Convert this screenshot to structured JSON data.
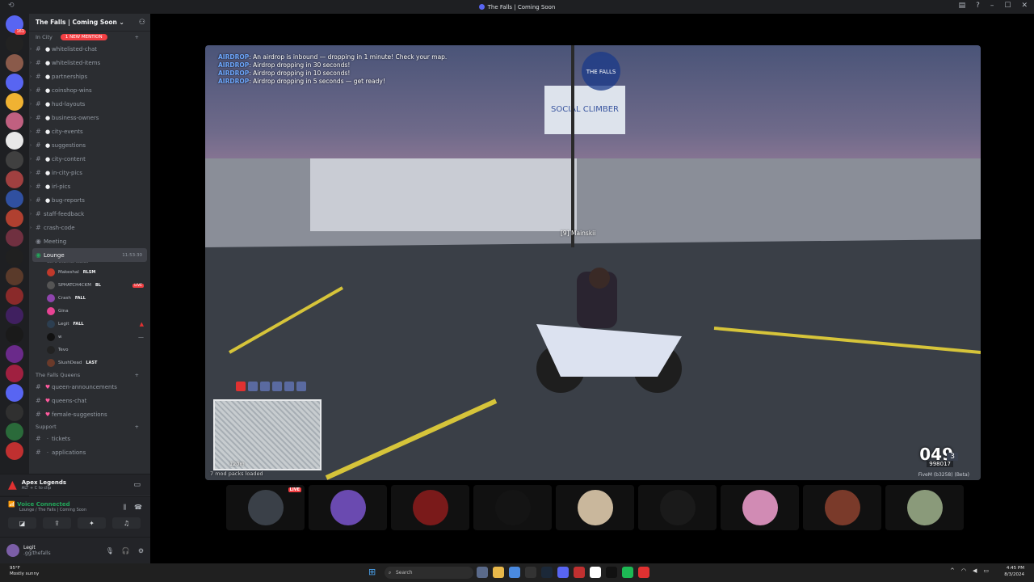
{
  "window": {
    "title": "The Falls | Coming Soon"
  },
  "server": {
    "name": "The Falls | Coming Soon"
  },
  "category_in_city": {
    "label": "In City",
    "badge": "1 NEW MENTION"
  },
  "channels": [
    {
      "name": "whitelisted-chat",
      "emoji": "💬"
    },
    {
      "name": "whitelisted-items",
      "emoji": "💬"
    },
    {
      "name": "partnerships",
      "emoji": "💬"
    },
    {
      "name": "coinshop-wins",
      "emoji": "💬"
    },
    {
      "name": "hud-layouts",
      "emoji": "💬"
    },
    {
      "name": "business-owners",
      "emoji": "💬"
    },
    {
      "name": "city-events",
      "emoji": "💬"
    },
    {
      "name": "suggestions",
      "emoji": "💬"
    },
    {
      "name": "city-content",
      "emoji": "💬"
    },
    {
      "name": "in-city-pics",
      "emoji": "💬"
    },
    {
      "name": "irl-pics",
      "emoji": "💬"
    },
    {
      "name": "bug-reports",
      "emoji": "💬"
    },
    {
      "name": "staff-feedback",
      "emoji": ""
    },
    {
      "name": "crash-code",
      "emoji": ""
    }
  ],
  "meeting": {
    "name": "Meeting"
  },
  "lounge": {
    "name": "Lounge",
    "time": "11:53:30",
    "status": "Set a channel status"
  },
  "voice_users": [
    {
      "name": "Makeshal",
      "tag": "RLSM",
      "right": ""
    },
    {
      "name": "SPHATCH4CKM",
      "tag": "BL",
      "right": "LIVE"
    },
    {
      "name": "Crash",
      "tag": "FALL",
      "right": ""
    },
    {
      "name": "Gina",
      "tag": "",
      "right": ""
    },
    {
      "name": "Legit",
      "tag": "FALL",
      "right": "apex"
    },
    {
      "name": "w",
      "tag": "",
      "right": "—"
    },
    {
      "name": "Tevo",
      "tag": "",
      "right": ""
    },
    {
      "name": "SlushDead",
      "tag": "LAST",
      "right": ""
    }
  ],
  "category_queens": {
    "label": "The Falls Queens"
  },
  "queens_channels": [
    {
      "name": "queen-announcements"
    },
    {
      "name": "queens-chat"
    },
    {
      "name": "female-suggestions"
    }
  ],
  "category_support": {
    "label": "Support"
  },
  "support_channels": [
    {
      "name": "tickets"
    },
    {
      "name": "applications"
    }
  ],
  "activity": {
    "game": "Apex Legends",
    "hint": "ALT + C  to clip"
  },
  "voice": {
    "status": "Voice Connected",
    "location": "Lounge / The Falls | Coming Soon"
  },
  "user": {
    "name": "Legit",
    "status": ".gg/thefalls"
  },
  "game": {
    "chat": [
      {
        "tag": "AIRDROP",
        "text": ": An airdrop is inbound — dropping in 1 minute! Check your map."
      },
      {
        "tag": "AIRDROP",
        "text": ": Airdrop dropping in 30 seconds!"
      },
      {
        "tag": "AIRDROP",
        "text": ": Airdrop dropping in 10 seconds!"
      },
      {
        "tag": "AIRDROP",
        "text": ": Airdrop dropping in 5 seconds — get ready!"
      }
    ],
    "player": "[9] Mainskii",
    "speed": "049",
    "gear": "3",
    "money": "998017",
    "fivem": "FiveM (b3258) (Beta)",
    "mods": "7 mod packs loaded",
    "zoom": "120m",
    "billboard": "SOCIAL CLIMBER",
    "logo": "THE FALLS"
  },
  "tiles": [
    {
      "color": "#3a4048",
      "live": "LIVE"
    },
    {
      "color": "#6a4ab0",
      "live": ""
    },
    {
      "color": "#7a1a1a",
      "live": ""
    },
    {
      "color": "#141414",
      "live": ""
    },
    {
      "color": "#c9b79c",
      "live": ""
    },
    {
      "color": "#1a1a1a",
      "live": ""
    },
    {
      "color": "#d18bb4",
      "live": ""
    },
    {
      "color": "#7a3a2a",
      "live": ""
    },
    {
      "color": "#8a9a7a",
      "live": ""
    }
  ],
  "taskbar": {
    "weather_temp": "95°F",
    "weather_desc": "Mostly sunny",
    "search": "Search",
    "time": "4:45 PM",
    "date": "8/3/2024"
  }
}
